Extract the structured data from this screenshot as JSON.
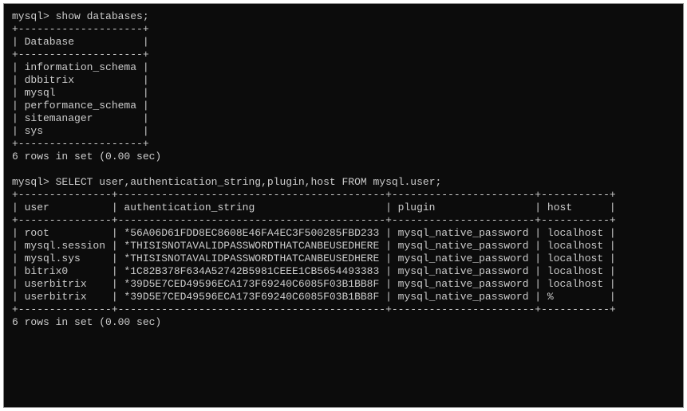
{
  "prompt": "mysql>",
  "command1": "show databases;",
  "table1": {
    "sep": "+--------------------+",
    "header_row": "| Database           |",
    "rows": [
      "| information_schema |",
      "| dbbitrix           |",
      "| mysql              |",
      "| performance_schema |",
      "| sitemanager        |",
      "| sys                |"
    ],
    "databases": [
      "information_schema",
      "dbbitrix",
      "mysql",
      "performance_schema",
      "sitemanager",
      "sys"
    ]
  },
  "result1": "6 rows in set (0.00 sec)",
  "command2": "SELECT user,authentication_string,plugin,host FROM mysql.user;",
  "table2": {
    "sep": "+---------------+-------------------------------------------+-----------------------+-----------+",
    "header_row": "| user          | authentication_string                     | plugin                | host      |",
    "rows": [
      "| root          | *56A06D61FDD8EC8608E46FA4EC3F500285FBD233 | mysql_native_password | localhost |",
      "| mysql.session | *THISISNOTAVALIDPASSWORDTHATCANBEUSEDHERE | mysql_native_password | localhost |",
      "| mysql.sys     | *THISISNOTAVALIDPASSWORDTHATCANBEUSEDHERE | mysql_native_password | localhost |",
      "| bitrix0       | *1C82B378F634A52742B5981CEEE1CB5654493383 | mysql_native_password | localhost |",
      "| userbitrix    | *39D5E7CED49596ECA173F69240C6085F03B1BB8F | mysql_native_password | localhost |",
      "| userbitrix    | *39D5E7CED49596ECA173F69240C6085F03B1BB8F | mysql_native_password | %         |"
    ],
    "columns": [
      "user",
      "authentication_string",
      "plugin",
      "host"
    ],
    "data": [
      {
        "user": "root",
        "authentication_string": "*56A06D61FDD8EC8608E46FA4EC3F500285FBD233",
        "plugin": "mysql_native_password",
        "host": "localhost"
      },
      {
        "user": "mysql.session",
        "authentication_string": "*THISISNOTAVALIDPASSWORDTHATCANBEUSEDHERE",
        "plugin": "mysql_native_password",
        "host": "localhost"
      },
      {
        "user": "mysql.sys",
        "authentication_string": "*THISISNOTAVALIDPASSWORDTHATCANBEUSEDHERE",
        "plugin": "mysql_native_password",
        "host": "localhost"
      },
      {
        "user": "bitrix0",
        "authentication_string": "*1C82B378F634A52742B5981CEEE1CB5654493383",
        "plugin": "mysql_native_password",
        "host": "localhost"
      },
      {
        "user": "userbitrix",
        "authentication_string": "*39D5E7CED49596ECA173F69240C6085F03B1BB8F",
        "plugin": "mysql_native_password",
        "host": "localhost"
      },
      {
        "user": "userbitrix",
        "authentication_string": "*39D5E7CED49596ECA173F69240C6085F03B1BB8F",
        "plugin": "mysql_native_password",
        "host": "%"
      }
    ]
  },
  "result2": "6 rows in set (0.00 sec)"
}
